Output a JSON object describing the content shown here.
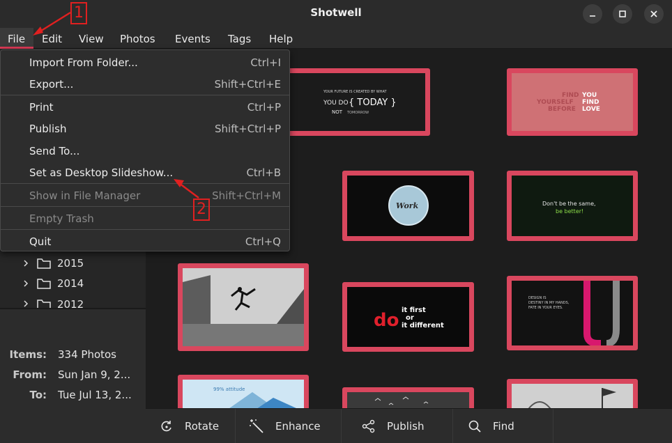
{
  "window": {
    "title": "Shotwell"
  },
  "menubar": [
    "File",
    "Edit",
    "View",
    "Photos",
    "Events",
    "Tags",
    "Help"
  ],
  "file_menu": {
    "items": [
      {
        "label": "Import From Folder...",
        "accel": "Ctrl+I",
        "disabled": false
      },
      {
        "label": "Export...",
        "accel": "Shift+Ctrl+E",
        "disabled": false
      },
      {
        "label": "Print",
        "accel": "Ctrl+P",
        "disabled": false
      },
      {
        "label": "Publish",
        "accel": "Shift+Ctrl+P",
        "disabled": false
      },
      {
        "label": "Send To...",
        "accel": "",
        "disabled": false
      },
      {
        "label": "Set as Desktop Slideshow...",
        "accel": "Ctrl+B",
        "disabled": false
      },
      {
        "label": "Show in File Manager",
        "accel": "Shift+Ctrl+M",
        "disabled": true
      },
      {
        "label": "Empty Trash",
        "accel": "",
        "disabled": true
      },
      {
        "label": "Quit",
        "accel": "Ctrl+Q",
        "disabled": false
      }
    ]
  },
  "sidebar": {
    "years": [
      "2015",
      "2014",
      "2012"
    ],
    "info": {
      "items_label": "Items:",
      "items_value": "334 Photos",
      "from_label": "From:",
      "from_value": "Sun Jan 9, 2...",
      "to_label": "To:",
      "to_value": "Tue Jul 13, 2..."
    }
  },
  "toolbar": {
    "rotate": "Rotate",
    "enhance": "Enhance",
    "publish": "Publish",
    "find": "Find"
  },
  "thumbnails": {
    "t1": {
      "l1": "YOUR FUTURE IS CREATED BY WHAT",
      "l2": "YOU DO",
      "l3": "{ TODAY }",
      "l4": "NOT",
      "l5": "TOMORROW"
    },
    "t2": {
      "l1": "FIND",
      "l2": "YOU",
      "l3": "YOURSELF",
      "l4": "FIND",
      "l5": "BEFORE",
      "l6": "LOVE"
    },
    "t3": {
      "l1": "Work"
    },
    "t4": {
      "l1": "Don't be the same,",
      "l2": "be better!"
    },
    "t5": {
      "l1": "do",
      "l2": "it first",
      "l3": "or",
      "l4": "it different"
    },
    "t6": {
      "l1": "DESIGN IS",
      "l2": "DESTINY IN MY HANDS,",
      "l3": "FATE IN YOUR EYES."
    },
    "t7": {
      "l1": "99% attitude"
    }
  },
  "annotations": {
    "one": "1",
    "two": "2"
  },
  "colors": {
    "accent": "#d9475e",
    "annotation": "#e02020"
  }
}
